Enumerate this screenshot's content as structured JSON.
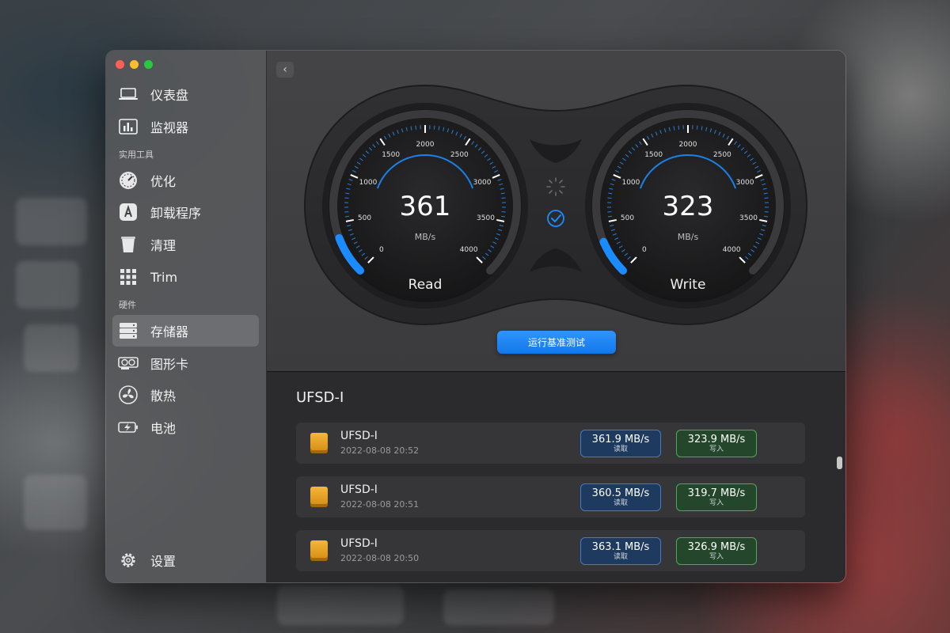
{
  "sidebar": {
    "items": [
      {
        "label": "仪表盘"
      },
      {
        "label": "监视器"
      },
      {
        "label": "优化"
      },
      {
        "label": "卸载程序"
      },
      {
        "label": "清理"
      },
      {
        "label": "Trim"
      },
      {
        "label": "存储器"
      },
      {
        "label": "图形卡"
      },
      {
        "label": "散热"
      },
      {
        "label": "电池"
      }
    ],
    "sections": [
      "实用工具",
      "硬件"
    ],
    "settings_label": "设置",
    "active": "存储器"
  },
  "gauges": {
    "read": {
      "value": "361",
      "unit": "MB/s",
      "label": "Read",
      "level": 361,
      "max": 4000
    },
    "write": {
      "value": "323",
      "unit": "MB/s",
      "label": "Write",
      "level": 323,
      "max": 4000
    },
    "ticks": [
      "0",
      "500",
      "1000",
      "1500",
      "2000",
      "2500",
      "3000",
      "3500",
      "4000"
    ]
  },
  "run_button": "运行基准测试",
  "device_title": "UFSD-I",
  "results": [
    {
      "name": "UFSD-I",
      "time": "2022-08-08 20:52",
      "read": "361.9 MB/s",
      "read_label": "读取",
      "write": "323.9 MB/s",
      "write_label": "写入"
    },
    {
      "name": "UFSD-I",
      "time": "2022-08-08 20:51",
      "read": "360.5 MB/s",
      "read_label": "读取",
      "write": "319.7 MB/s",
      "write_label": "写入"
    },
    {
      "name": "UFSD-I",
      "time": "2022-08-08 20:50",
      "read": "363.1 MB/s",
      "read_label": "读取",
      "write": "326.9 MB/s",
      "write_label": "写入"
    }
  ],
  "colors": {
    "accent": "#1a8cff",
    "read_bg": "#1e3a5f",
    "write_bg": "#24472b"
  }
}
